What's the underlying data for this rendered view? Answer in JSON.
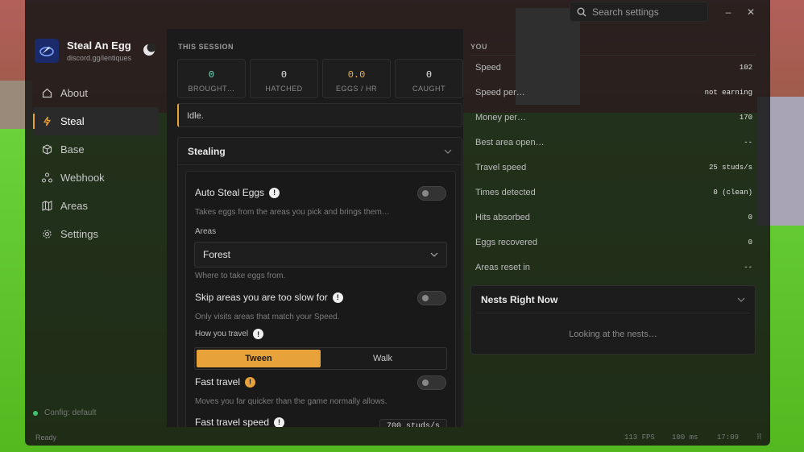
{
  "window": {
    "search_placeholder": "Search settings",
    "minimize_glyph": "–",
    "close_glyph": "✕"
  },
  "brand": {
    "title": "Steal An Egg",
    "subtitle": "discord.gg/ientiques"
  },
  "sidebar": {
    "items": [
      {
        "label": "About",
        "icon": "home-icon"
      },
      {
        "label": "Steal",
        "icon": "lightning-icon",
        "active": true
      },
      {
        "label": "Base",
        "icon": "cube-icon"
      },
      {
        "label": "Webhook",
        "icon": "webhook-icon"
      },
      {
        "label": "Areas",
        "icon": "map-icon"
      },
      {
        "label": "Settings",
        "icon": "gear-icon"
      }
    ],
    "config": "Config: default"
  },
  "session": {
    "label": "THIS SESSION",
    "stats": [
      {
        "value": "0",
        "label": "BROUGHT…",
        "color": "#7fd8c4"
      },
      {
        "value": "0",
        "label": "HATCHED",
        "color": "#e8e8e8"
      },
      {
        "value": "0.0",
        "label": "EGGS / HR",
        "color": "#f0b24a"
      },
      {
        "value": "0",
        "label": "CAUGHT",
        "color": "#e8e8e8"
      }
    ],
    "status": "Idle."
  },
  "stealing": {
    "title": "Stealing",
    "auto_steal": {
      "label": "Auto Steal Eggs",
      "desc": "Takes eggs from the areas you pick and brings them…"
    },
    "areas_label": "Areas",
    "areas_value": "Forest",
    "areas_desc": "Where to take eggs from.",
    "skip": {
      "label": "Skip areas you are too slow for",
      "desc": "Only visits areas that match your Speed."
    },
    "travel_label": "How you travel",
    "travel_options": [
      "Tween",
      "Walk"
    ],
    "fast_travel": {
      "label": "Fast travel",
      "desc": "Moves you far quicker than the game normally allows."
    },
    "fast_speed_label": "Fast travel speed",
    "fast_speed_value": "700 studs/s"
  },
  "you": {
    "label": "YOU",
    "rows": [
      {
        "k": "Speed",
        "v": "102"
      },
      {
        "k": "Speed per…",
        "v": "not earning"
      },
      {
        "k": "Money per…",
        "v": "170"
      },
      {
        "k": "Best area open…",
        "v": "--"
      },
      {
        "k": "Travel speed",
        "v": "25 studs/s"
      },
      {
        "k": "Times detected",
        "v": "0 (clean)"
      },
      {
        "k": "Hits absorbed",
        "v": "0"
      },
      {
        "k": "Eggs recovered",
        "v": "0"
      },
      {
        "k": "Areas reset in",
        "v": "--"
      }
    ]
  },
  "nests": {
    "title": "Nests Right Now",
    "body": "Looking at the nests…"
  },
  "footer": {
    "status": "Ready",
    "fps": "113 FPS",
    "ping": "100 ms",
    "time": "17:09"
  },
  "colors": {
    "accent": "#e8a23a",
    "online": "#3fc46b"
  }
}
